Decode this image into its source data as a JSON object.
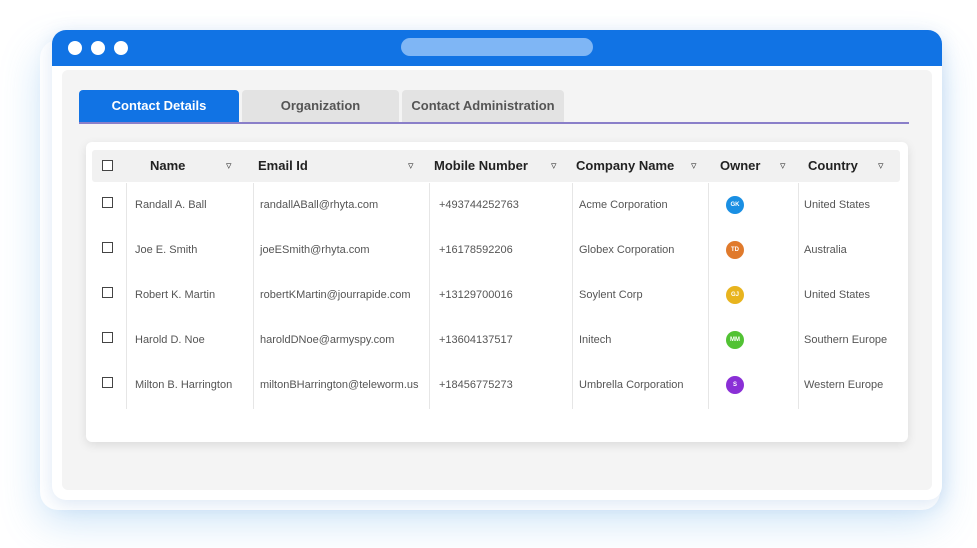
{
  "tabs": [
    {
      "label": "Contact Details",
      "active": true
    },
    {
      "label": "Organization",
      "active": false
    },
    {
      "label": "Contact Administration",
      "active": false
    }
  ],
  "table": {
    "columns": [
      "Name",
      "Email Id",
      "Mobile Number",
      "Company Name",
      "Owner",
      "Country"
    ],
    "filter_icon": "filter-icon",
    "rows": [
      {
        "name": "Randall A. Ball",
        "email": "randallABall@rhyta.com",
        "mobile": "+493744252763",
        "company": "Acme Corporation",
        "owner": "GK",
        "owner_color": "#1a8fe3",
        "country": "United States"
      },
      {
        "name": "Joe E. Smith",
        "email": "joeESmith@rhyta.com",
        "mobile": "+16178592206",
        "company": "Globex Corporation",
        "owner": "TD",
        "owner_color": "#e07a2c",
        "country": "Australia"
      },
      {
        "name": "Robert K. Martin",
        "email": "robertKMartin@jourrapide.com",
        "mobile": "+13129700016",
        "company": "Soylent Corp",
        "owner": "GJ",
        "owner_color": "#e8b41e",
        "country": "United States"
      },
      {
        "name": "Harold D. Noe",
        "email": "haroldDNoe@armyspy.com",
        "mobile": "+13604137517",
        "company": "Initech",
        "owner": "MM",
        "owner_color": "#52c234",
        "country": "Southern Europe"
      },
      {
        "name": "Milton B. Harrington",
        "email": "miltonBHarrington@teleworm.us",
        "mobile": "+18456775273",
        "company": "Umbrella Corporation",
        "owner": "S",
        "owner_color": "#8a2fd6",
        "country": "Western Europe"
      }
    ]
  },
  "colors": {
    "accent": "#1173e4",
    "tab_underline": "#8a7fc9"
  }
}
